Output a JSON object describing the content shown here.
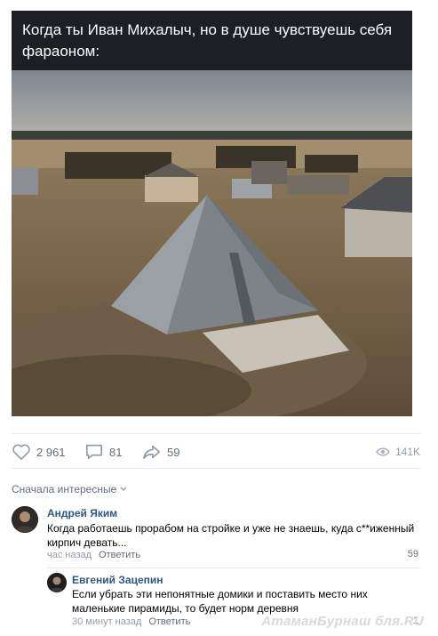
{
  "caption": "Когда ты Иван Михалыч, но в душе чувствуешь себя фараоном:",
  "stats": {
    "likes": "2 961",
    "comments": "81",
    "shares": "59",
    "views": "141K"
  },
  "sort_label": "Сначала интересные",
  "comments": [
    {
      "author": "Андрей Яким",
      "text": "Когда работаешь прорабом на стройке и уже не знаешь, куда с**иженный кирпич девать...",
      "time": "час назад",
      "reply_label": "Ответить",
      "likes": "59"
    },
    {
      "author": "Евгений Зацепин",
      "text": "Если убрать эти непонятные домики и поставить место них маленькие пирамиды, то будет норм деревня",
      "time": "30 минут назад",
      "reply_label": "Ответить",
      "likes": "1"
    }
  ],
  "watermark": "АтаманБурнаш бля.RU",
  "colors": {
    "caption_bg": "#1c1f23",
    "link": "#2a5885",
    "muted": "#626d7a",
    "light": "#939cab"
  }
}
